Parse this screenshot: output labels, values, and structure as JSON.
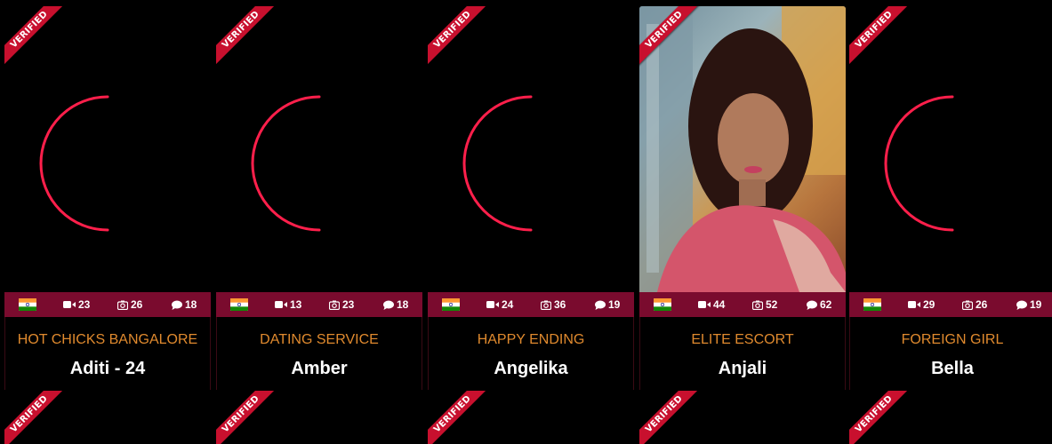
{
  "ribbon_label": "VERIFIED",
  "colors": {
    "stats_bar": "#7a0b2e",
    "category_text": "#e08a2e",
    "ribbon": "#c8102e",
    "loader": "#ff1f4b"
  },
  "profiles": [
    {
      "category": "HOT CHICKS BANGALORE",
      "name": "Aditi - 24",
      "country_flag": "india-flag-icon",
      "videos": "23",
      "photos": "26",
      "comments": "18",
      "image_loaded": false
    },
    {
      "category": "DATING SERVICE",
      "name": "Amber",
      "country_flag": "india-flag-icon",
      "videos": "13",
      "photos": "23",
      "comments": "18",
      "image_loaded": false
    },
    {
      "category": "HAPPY ENDING",
      "name": "Angelika",
      "country_flag": "india-flag-icon",
      "videos": "24",
      "photos": "36",
      "comments": "19",
      "image_loaded": false
    },
    {
      "category": "ELITE ESCORT",
      "name": "Anjali",
      "country_flag": "india-flag-icon",
      "videos": "44",
      "photos": "52",
      "comments": "62",
      "image_loaded": true
    },
    {
      "category": "FOREIGN GIRL",
      "name": "Bella",
      "country_flag": "india-flag-icon",
      "videos": "29",
      "photos": "26",
      "comments": "19",
      "image_loaded": false
    }
  ],
  "next_row_cards": 5
}
